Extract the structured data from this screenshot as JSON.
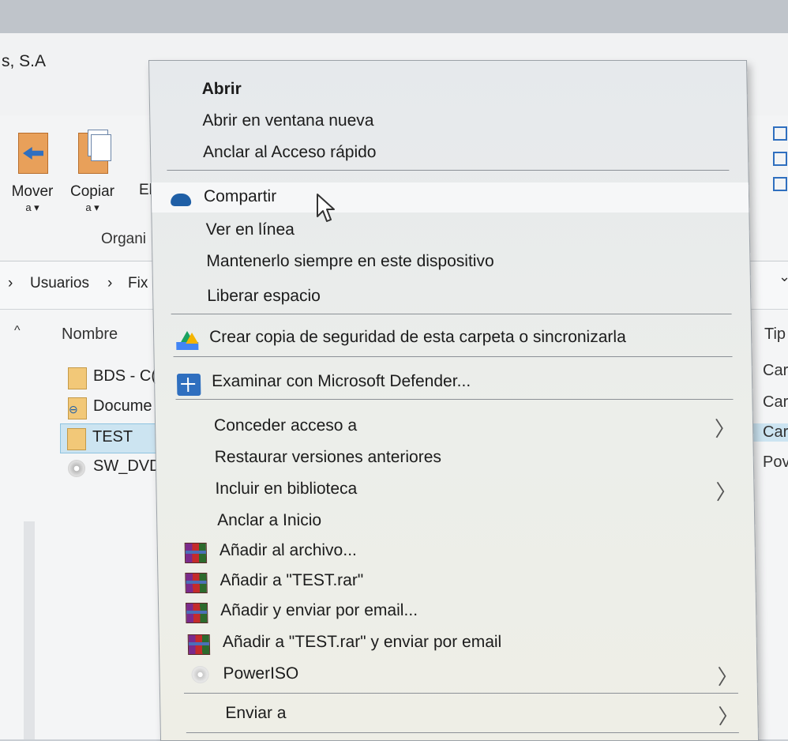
{
  "window": {
    "title": "s, S.A"
  },
  "ribbon": {
    "move": {
      "label": "Mover",
      "sub": "a ▾"
    },
    "copy": {
      "label": "Copiar",
      "sub": "a ▾"
    },
    "partial_label": "El",
    "group_label": "Organi"
  },
  "address": {
    "crumbs": [
      "›",
      "Usuarios",
      "›",
      "Fix"
    ]
  },
  "filelist": {
    "name_header": "Nombre",
    "type_header": "Tip",
    "files": [
      {
        "name": "BDS - C(",
        "type": "Car"
      },
      {
        "name": "Docume",
        "type": "Car"
      },
      {
        "name": "TEST",
        "type": "Car",
        "selected": true
      },
      {
        "name": "SW_DVD",
        "type": "Pov"
      }
    ]
  },
  "context_menu": {
    "items": [
      {
        "label": "Abrir",
        "bold": true
      },
      {
        "label": "Abrir en ventana nueva"
      },
      {
        "label": "Anclar al Acceso rápido"
      },
      {
        "label": "Compartir",
        "icon": "onedrive-icon",
        "hover": true
      },
      {
        "label": "Ver en línea"
      },
      {
        "label": "Mantenerlo siempre en este dispositivo"
      },
      {
        "label": "Liberar espacio"
      },
      {
        "label": "Crear copia de seguridad de esta carpeta o sincronizarla",
        "icon": "google-drive-icon"
      },
      {
        "label": "Examinar con Microsoft Defender...",
        "icon": "defender-icon"
      },
      {
        "label": "Conceder acceso a",
        "submenu": true
      },
      {
        "label": "Restaurar versiones anteriores"
      },
      {
        "label": "Incluir en biblioteca",
        "submenu": true
      },
      {
        "label": "Anclar a Inicio"
      },
      {
        "label": "Añadir al archivo...",
        "icon": "winrar-icon"
      },
      {
        "label": "Añadir a \"TEST.rar\"",
        "icon": "winrar-icon"
      },
      {
        "label": "Añadir y enviar por email...",
        "icon": "winrar-icon"
      },
      {
        "label": "Añadir a \"TEST.rar\" y enviar por email",
        "icon": "winrar-icon"
      },
      {
        "label": "PowerISO",
        "icon": "poweriso-icon",
        "submenu": true
      },
      {
        "label": "Enviar a",
        "submenu": true
      }
    ],
    "submenu_glyph": "〉"
  }
}
